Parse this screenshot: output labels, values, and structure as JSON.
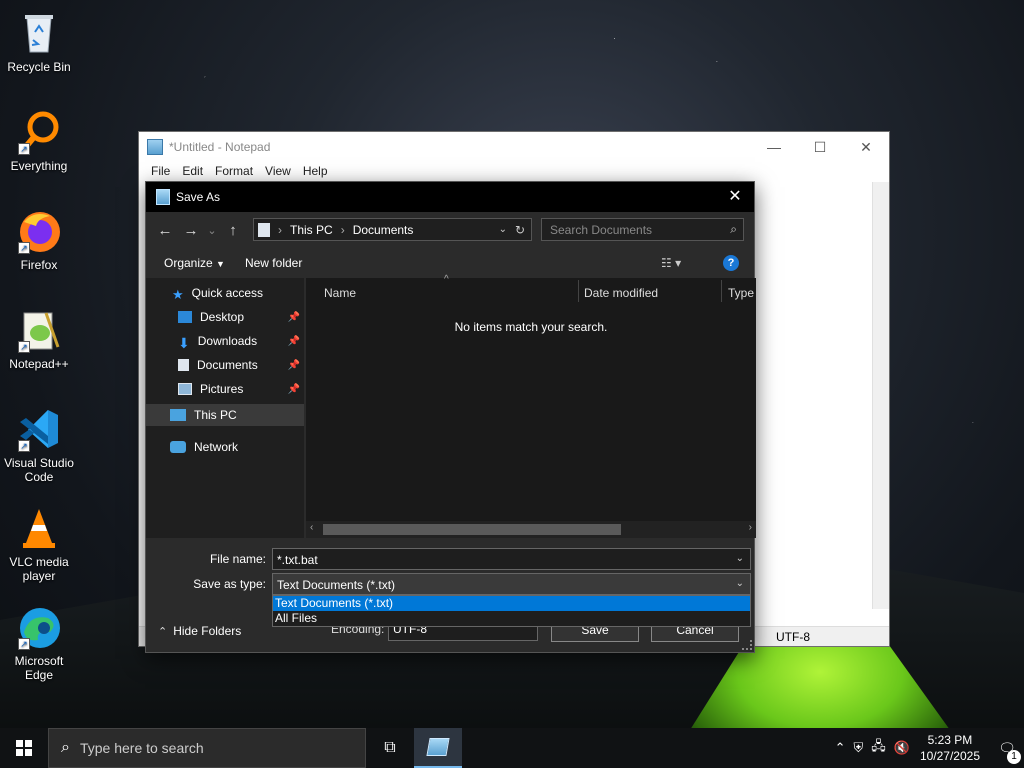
{
  "desktop": {
    "icons": [
      {
        "label": "Recycle Bin"
      },
      {
        "label": "Everything"
      },
      {
        "label": "Firefox"
      },
      {
        "label": "Notepad++"
      },
      {
        "label": "Visual Studio Code"
      },
      {
        "label": "VLC media player"
      },
      {
        "label": "Microsoft Edge"
      }
    ]
  },
  "notepad": {
    "title": "*Untitled - Notepad",
    "menu": [
      "File",
      "Edit",
      "Format",
      "View",
      "Help"
    ],
    "status_encoding": "UTF-8"
  },
  "dialog": {
    "title": "Save As",
    "breadcrumb": [
      "This PC",
      "Documents"
    ],
    "search_placeholder": "Search Documents",
    "toolbar": {
      "organize": "Organize",
      "new_folder": "New folder"
    },
    "nav": {
      "quick_access": "Quick access",
      "desktop": "Desktop",
      "downloads": "Downloads",
      "documents": "Documents",
      "pictures": "Pictures",
      "this_pc": "This PC",
      "network": "Network"
    },
    "columns": {
      "name": "Name",
      "date_modified": "Date modified",
      "type": "Type"
    },
    "empty_message": "No items match your search.",
    "file_name_label": "File name:",
    "file_name_value": "*.txt.bat",
    "save_type_label": "Save as type:",
    "save_type_value": "Text Documents (*.txt)",
    "save_type_options": [
      "Text Documents (*.txt)",
      "All Files"
    ],
    "hide_folders": "Hide Folders",
    "encoding_label": "Encoding:",
    "encoding_value": "UTF-8",
    "save_button": "Save",
    "cancel_button": "Cancel"
  },
  "taskbar": {
    "search_placeholder": "Type here to search",
    "time": "5:23 PM",
    "date": "10/27/2025",
    "notification_count": "1"
  }
}
